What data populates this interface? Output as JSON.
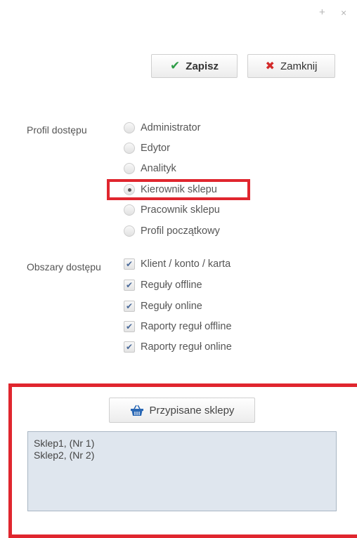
{
  "window": {
    "plus_glyph": "+",
    "close_glyph": "×"
  },
  "toolbar": {
    "save_label": "Zapisz",
    "close_label": "Zamknij"
  },
  "profile": {
    "label": "Profil dostępu",
    "options": [
      {
        "label": "Administrator",
        "selected": false
      },
      {
        "label": "Edytor",
        "selected": false
      },
      {
        "label": "Analityk",
        "selected": false
      },
      {
        "label": "Kierownik sklepu",
        "selected": true
      },
      {
        "label": "Pracownik sklepu",
        "selected": false
      },
      {
        "label": "Profil początkowy",
        "selected": false
      }
    ]
  },
  "areas": {
    "label": "Obszary dostępu",
    "options": [
      {
        "label": "Klient / konto / karta",
        "checked": true
      },
      {
        "label": "Reguły offline",
        "checked": true
      },
      {
        "label": "Reguły online",
        "checked": true
      },
      {
        "label": "Raporty reguł offline",
        "checked": true
      },
      {
        "label": "Raporty reguł online",
        "checked": true
      }
    ]
  },
  "shops": {
    "button_label": "Przypisane sklepy",
    "items": [
      "Sklep1,  (Nr 1)",
      "Sklep2,  (Nr 2)"
    ]
  },
  "colors": {
    "accent_red": "#e0262e",
    "check_green": "#2e9d47"
  }
}
